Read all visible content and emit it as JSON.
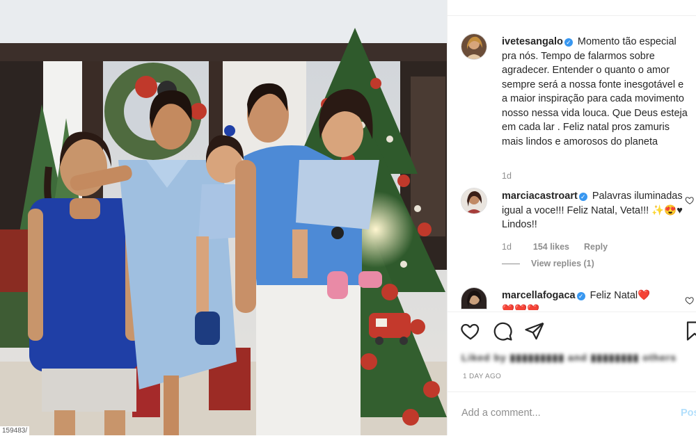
{
  "photo": {
    "alt": "",
    "url_fragment": "159483/"
  },
  "caption": {
    "username": "ivetesangalo",
    "text": "Momento tão especial pra nós. Tempo de falarmos sobre agradecer. Entender o quanto o amor sempre será a nossa fonte inesgotável e a maior inspiração para cada movimento nosso nessa vida louca. Que Deus esteja em cada lar . Feliz natal pros zamuris mais lindos e amorosos do planeta",
    "time": "1d"
  },
  "comments": [
    {
      "username": "marciacastroart",
      "text": "Palavras iluminadas igual a voce!!! Feliz Natal, Veta!!! ✨😍♥ Lindos!!",
      "time": "1d",
      "likes": "154 likes",
      "reply": "Reply",
      "view_replies": "View replies (1)"
    },
    {
      "username": "marcellafogaca",
      "text": "Feliz Natal❤️",
      "extra": "❤️❤️❤️"
    }
  ],
  "actions": {
    "like_icon": "heart-outline-icon",
    "comment_icon": "speech-bubble-icon",
    "share_icon": "paper-plane-icon",
    "save_icon": "bookmark-icon"
  },
  "likes_line": "Liked by ▮▮▮▮▮▮▮▮▮ and ▮▮▮▮▮▮▮▮ others",
  "time_ago": "1 DAY AGO",
  "add_comment": {
    "placeholder": "Add a comment...",
    "post_label": "Post"
  },
  "colors": {
    "verified": "#3897f0",
    "heart_red": "#ed4956",
    "muted": "#8e8e8e"
  }
}
